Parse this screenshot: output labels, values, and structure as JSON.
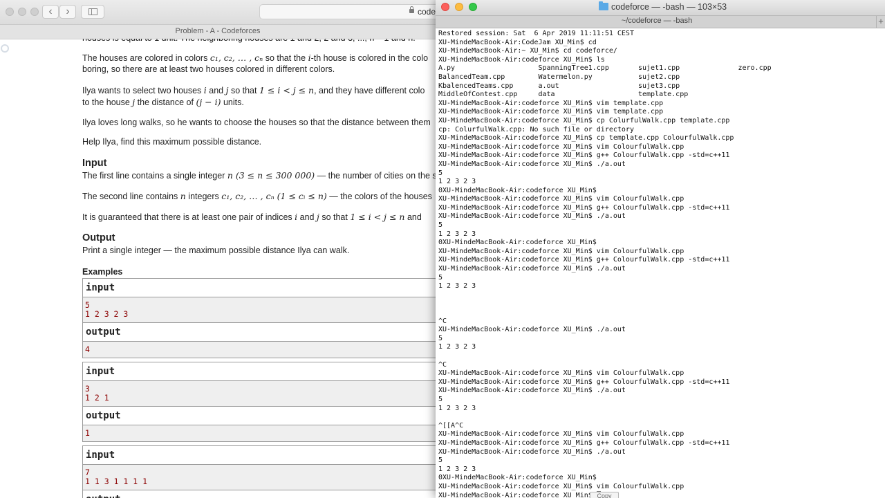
{
  "safari": {
    "address": "code",
    "tab_title": "Problem - A - Codeforces",
    "nav_back": "‹",
    "nav_forward": "›"
  },
  "problem": {
    "cut_line": "houses is equal to 1 unit. The neighboring houses are 1 and 2, 2 and 3, ..., n − 1 and n.",
    "para1_l1_a": "The houses are colored in colors ",
    "para1_l1_math": "c₁, c₂, … , cₙ",
    "para1_l1_b": " so that the ",
    "para1_l1_math2": "i",
    "para1_l1_c": "-th house is colored in the colo",
    "para1_l2": "boring, so there are at least two houses colored in different colors.",
    "para2_l1_a": "Ilya wants to select two houses ",
    "para2_l1_m1": "i",
    "para2_l1_b": " and ",
    "para2_l1_m2": "j",
    "para2_l1_c": " so that ",
    "para2_l1_m3": "1 ≤ i < j ≤ n",
    "para2_l1_d": ", and they have different colo",
    "para2_l2_a": "to the house ",
    "para2_l2_m1": "j",
    "para2_l2_b": " the distance of ",
    "para2_l2_m2": "(j − i)",
    "para2_l2_c": " units.",
    "para3": "Ilya loves long walks, so he wants to choose the houses so that the distance between them",
    "para4": "Help Ilya, find this maximum possible distance.",
    "input_heading": "Input",
    "input_l1_a": "The first line contains a single integer ",
    "input_l1_m": "n (3 ≤ n ≤ 300 000)",
    "input_l1_b": " — the number of cities on the s",
    "input_l2_a": "The second line contains ",
    "input_l2_m1": "n",
    "input_l2_b": " integers ",
    "input_l2_m2": "c₁, c₂, … , cₙ (1 ≤ cᵢ ≤ n)",
    "input_l2_c": " — the colors of the houses",
    "input_l3_a": "It is guaranteed that there is at least one pair of indices ",
    "input_l3_m1": "i",
    "input_l3_b": " and ",
    "input_l3_m2": "j",
    "input_l3_c": " so that ",
    "input_l3_m3": "1 ≤ i < j ≤ n",
    "input_l3_d": " and",
    "output_heading": "Output",
    "output_l1": "Print a single integer — the maximum possible distance Ilya can walk.",
    "examples_label": "Examples",
    "examples": [
      {
        "input_label": "input",
        "input": "5\n1 2 3 2 3",
        "output_label": "output",
        "output": "4"
      },
      {
        "input_label": "input",
        "input": "3\n1 2 1",
        "output_label": "output",
        "output": "1"
      },
      {
        "input_label": "input",
        "input": "7\n1 1 3 1 1 1 1",
        "output_label": "output",
        "output": ""
      }
    ]
  },
  "terminal": {
    "title": "codeforce — -bash — 103×53",
    "tab_label": "~/codeforce — -bash",
    "tab_add": "+",
    "tooltip": "Copy",
    "lines": [
      "Restored session: Sat  6 Apr 2019 11:11:51 CEST",
      "XU-MindeMacBook-Air:CodeJam XU_Min$ cd",
      "XU-MindeMacBook-Air:~ XU_Min$ cd codeforce/",
      "XU-MindeMacBook-Air:codeforce XU_Min$ ls",
      "A.py                    SpanningTree1.cpp       sujet1.cpp              zero.cpp",
      "BalancedTeam.cpp        Watermelon.py           sujet2.cpp",
      "KbalencedTeams.cpp      a.out                   sujet3.cpp",
      "MiddleOfContest.cpp     data                    template.cpp",
      "XU-MindeMacBook-Air:codeforce XU_Min$ vim template.cpp",
      "XU-MindeMacBook-Air:codeforce XU_Min$ vim template.cpp",
      "XU-MindeMacBook-Air:codeforce XU_Min$ cp ColurfulWalk.cpp template.cpp",
      "cp: ColurfulWalk.cpp: No such file or directory",
      "XU-MindeMacBook-Air:codeforce XU_Min$ cp template.cpp ColourfulWalk.cpp",
      "XU-MindeMacBook-Air:codeforce XU_Min$ vim ColourfulWalk.cpp",
      "XU-MindeMacBook-Air:codeforce XU_Min$ g++ ColourfulWalk.cpp -std=c++11",
      "XU-MindeMacBook-Air:codeforce XU_Min$ ./a.out",
      "5",
      "1 2 3 2 3",
      "0XU-MindeMacBook-Air:codeforce XU_Min$",
      "XU-MindeMacBook-Air:codeforce XU_Min$ vim ColourfulWalk.cpp",
      "XU-MindeMacBook-Air:codeforce XU_Min$ g++ ColourfulWalk.cpp -std=c++11",
      "XU-MindeMacBook-Air:codeforce XU_Min$ ./a.out",
      "5",
      "1 2 3 2 3",
      "0XU-MindeMacBook-Air:codeforce XU_Min$",
      "XU-MindeMacBook-Air:codeforce XU_Min$ vim ColourfulWalk.cpp",
      "XU-MindeMacBook-Air:codeforce XU_Min$ g++ ColourfulWalk.cpp -std=c++11",
      "XU-MindeMacBook-Air:codeforce XU_Min$ ./a.out",
      "5",
      "1 2 3 2 3",
      "",
      "",
      "",
      "^C",
      "XU-MindeMacBook-Air:codeforce XU_Min$ ./a.out",
      "5",
      "1 2 3 2 3",
      "",
      "^C",
      "XU-MindeMacBook-Air:codeforce XU_Min$ vim ColourfulWalk.cpp",
      "XU-MindeMacBook-Air:codeforce XU_Min$ g++ ColourfulWalk.cpp -std=c++11",
      "XU-MindeMacBook-Air:codeforce XU_Min$ ./a.out",
      "5",
      "1 2 3 2 3",
      "",
      "^[[A^C",
      "XU-MindeMacBook-Air:codeforce XU_Min$ vim ColourfulWalk.cpp",
      "XU-MindeMacBook-Air:codeforce XU_Min$ g++ ColourfulWalk.cpp -std=c++11",
      "XU-MindeMacBook-Air:codeforce XU_Min$ ./a.out",
      "5",
      "1 2 3 2 3",
      "0XU-MindeMacBook-Air:codeforce XU_Min$",
      "XU-MindeMacBook-Air:codeforce XU_Min$ vim ColourfulWalk.cpp"
    ],
    "prompt": "XU-MindeMacBook-Air:codeforce XU_Min$ "
  }
}
